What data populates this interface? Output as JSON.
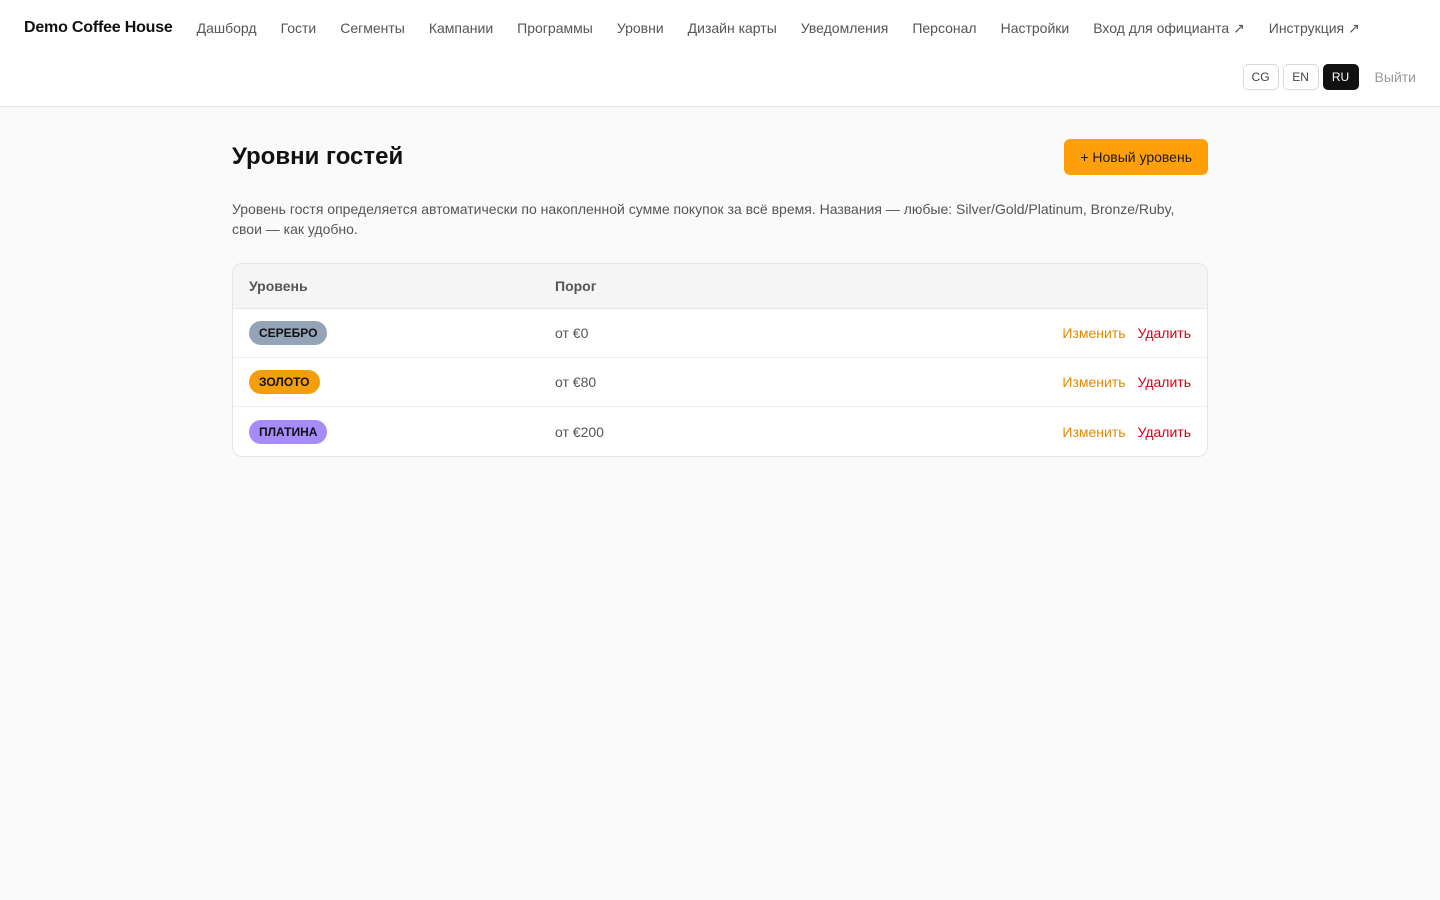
{
  "header": {
    "brand": "Demo Coffee House",
    "nav": [
      {
        "id": "dashboard",
        "label": "Дашборд"
      },
      {
        "id": "guests",
        "label": "Гости"
      },
      {
        "id": "segments",
        "label": "Сегменты"
      },
      {
        "id": "campaigns",
        "label": "Кампании"
      },
      {
        "id": "programs",
        "label": "Программы"
      },
      {
        "id": "levels",
        "label": "Уровни"
      },
      {
        "id": "card-design",
        "label": "Дизайн карты"
      },
      {
        "id": "notifications",
        "label": "Уведомления"
      },
      {
        "id": "staff",
        "label": "Персонал"
      },
      {
        "id": "settings",
        "label": "Настройки"
      },
      {
        "id": "waiter-login",
        "label": "Вход для официанта ↗"
      },
      {
        "id": "instructions",
        "label": "Инструкция ↗"
      }
    ],
    "languages": [
      {
        "code": "CG",
        "active": false
      },
      {
        "code": "EN",
        "active": false
      },
      {
        "code": "RU",
        "active": true
      }
    ],
    "logout_label": "Выйти"
  },
  "page": {
    "title": "Уровни гостей",
    "new_button_label": "+ Новый уровень",
    "description": "Уровень гостя определяется автоматически по накопленной сумме покупок за всё время. Названия — любые: Silver/Gold/Platinum, Bronze/Ruby, свои — как удобно."
  },
  "table": {
    "headers": {
      "level": "Уровень",
      "threshold": "Порог"
    },
    "rows": [
      {
        "name": "Серебро",
        "threshold": "от €0",
        "color": "#94a3b8"
      },
      {
        "name": "Золото",
        "threshold": "от €80",
        "color": "#f59e0b"
      },
      {
        "name": "Платина",
        "threshold": "от €200",
        "color": "#a78bfa"
      }
    ],
    "edit_label": "Изменить",
    "delete_label": "Удалить"
  },
  "colors": {
    "accent": "#ff9f0a",
    "edit": "#e08a00",
    "delete": "#d0021b"
  }
}
